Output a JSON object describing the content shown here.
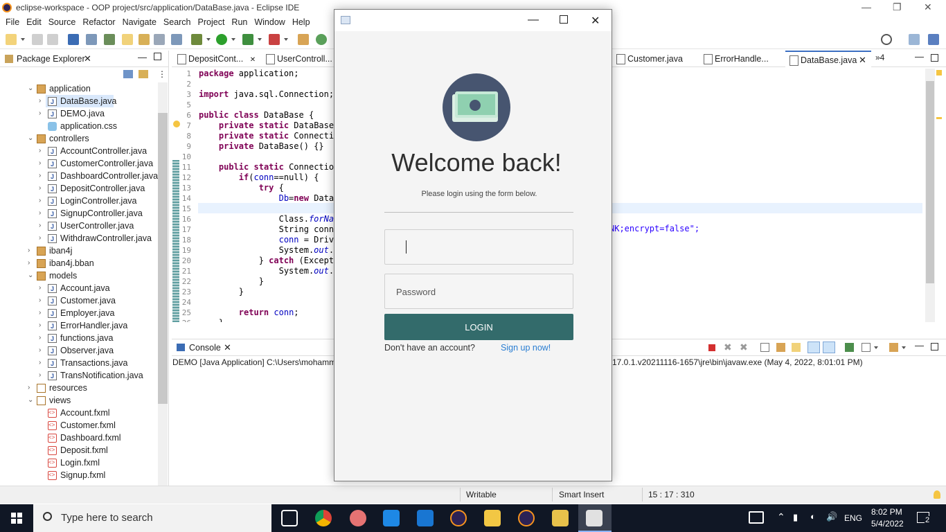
{
  "window": {
    "title": "eclipse-workspace - OOP project/src/application/DataBase.java - Eclipse IDE"
  },
  "menu": [
    "File",
    "Edit",
    "Source",
    "Refactor",
    "Navigate",
    "Search",
    "Project",
    "Run",
    "Window",
    "Help"
  ],
  "package_explorer": {
    "title": "Package Explorer",
    "tree": [
      {
        "label": "application",
        "type": "pkg",
        "level": 0,
        "expanded": true
      },
      {
        "label": "DataBase.java",
        "type": "java",
        "level": 1,
        "selected": true
      },
      {
        "label": "DEMO.java",
        "type": "java",
        "level": 1
      },
      {
        "label": "application.css",
        "type": "css",
        "level": 1
      },
      {
        "label": "controllers",
        "type": "pkg",
        "level": 0,
        "expanded": true
      },
      {
        "label": "AccountController.java",
        "type": "java",
        "level": 1
      },
      {
        "label": "CustomerController.java",
        "type": "java",
        "level": 1
      },
      {
        "label": "DashboardController.java",
        "type": "java",
        "level": 1
      },
      {
        "label": "DepositController.java",
        "type": "java",
        "level": 1
      },
      {
        "label": "LoginController.java",
        "type": "java",
        "level": 1
      },
      {
        "label": "SignupController.java",
        "type": "java",
        "level": 1
      },
      {
        "label": "UserController.java",
        "type": "java",
        "level": 1
      },
      {
        "label": "WithdrawController.java",
        "type": "java",
        "level": 1
      },
      {
        "label": "iban4j",
        "type": "pkg",
        "level": 0
      },
      {
        "label": "iban4j.bban",
        "type": "pkg",
        "level": 0
      },
      {
        "label": "models",
        "type": "pkg",
        "level": 0,
        "expanded": true
      },
      {
        "label": "Account.java",
        "type": "java",
        "level": 1
      },
      {
        "label": "Customer.java",
        "type": "java",
        "level": 1
      },
      {
        "label": "Employer.java",
        "type": "java",
        "level": 1
      },
      {
        "label": "ErrorHandler.java",
        "type": "java",
        "level": 1
      },
      {
        "label": "functions.java",
        "type": "java",
        "level": 1
      },
      {
        "label": "Observer.java",
        "type": "java",
        "level": 1
      },
      {
        "label": "Transactions.java",
        "type": "java",
        "level": 1
      },
      {
        "label": "TransNotification.java",
        "type": "java",
        "level": 1
      },
      {
        "label": "resources",
        "type": "res",
        "level": 0
      },
      {
        "label": "views",
        "type": "res",
        "level": 0,
        "expanded": true
      },
      {
        "label": "Account.fxml",
        "type": "fxml",
        "level": 1
      },
      {
        "label": "Customer.fxml",
        "type": "fxml",
        "level": 1
      },
      {
        "label": "Dashboard.fxml",
        "type": "fxml",
        "level": 1
      },
      {
        "label": "Deposit.fxml",
        "type": "fxml",
        "level": 1
      },
      {
        "label": "Login.fxml",
        "type": "fxml",
        "level": 1
      },
      {
        "label": "Signup.fxml",
        "type": "fxml",
        "level": 1
      }
    ]
  },
  "editor_tabs": [
    {
      "label": "DepositCont..."
    },
    {
      "label": "UserControll..."
    },
    {
      "label": "Customer.java"
    },
    {
      "label": "ErrorHandle..."
    },
    {
      "label": "DataBase.java",
      "active": true
    }
  ],
  "editor_overflow": "»4",
  "code_lines": [
    {
      "n": "1",
      "text": "package application;"
    },
    {
      "n": "2",
      "text": ""
    },
    {
      "n": "3",
      "text": "import java.sql.Connection;"
    },
    {
      "n": "5",
      "text": ""
    },
    {
      "n": "6",
      "text": "public class DataBase {"
    },
    {
      "n": "7",
      "text": "    private static DataBase"
    },
    {
      "n": "8",
      "text": "    private static Connectio"
    },
    {
      "n": "9",
      "text": "    private DataBase() {}"
    },
    {
      "n": "10",
      "text": ""
    },
    {
      "n": "11",
      "text": "    public static Connection"
    },
    {
      "n": "12",
      "text": "        if(conn==null) {"
    },
    {
      "n": "13",
      "text": "            try {"
    },
    {
      "n": "14",
      "text": "                Db=new DataB"
    },
    {
      "n": "15",
      "text": ""
    },
    {
      "n": "16",
      "text": "                Class.forNam"
    },
    {
      "n": "17",
      "text": "                String conne"
    },
    {
      "n": "18",
      "text": "                conn = Drive"
    },
    {
      "n": "19",
      "text": "                System.out.p"
    },
    {
      "n": "20",
      "text": "            } catch (Excepti"
    },
    {
      "n": "21",
      "text": "                System.out.p"
    },
    {
      "n": "22",
      "text": "            }"
    },
    {
      "n": "23",
      "text": "        }"
    },
    {
      "n": "24",
      "text": ""
    },
    {
      "n": "25",
      "text": "        return conn;"
    },
    {
      "n": "26",
      "text": "    }"
    }
  ],
  "code_tail_17": "NK;encrypt=false\";",
  "console": {
    "title": "Console",
    "launch_left": "DEMO [Java Application] C:\\Users\\mohamm",
    "launch_right": "17.0.1.v20211116-1657\\jre\\bin\\javaw.exe  (May 4, 2022, 8:01:01 PM)"
  },
  "status": {
    "writable": "Writable",
    "insert_mode": "Smart Insert",
    "position": "15 : 17 : 310"
  },
  "login": {
    "welcome": "Welcome back!",
    "subtitle": "Please login using the form below.",
    "username_value": "",
    "password_placeholder": "Password",
    "login_button": "LOGIN",
    "no_account": "Don't have an account?",
    "signup_link": "Sign up now!",
    "colors": {
      "button": "#336b6b",
      "logo_bg": "#475570",
      "link": "#2a7ed2"
    }
  },
  "taskbar": {
    "search_placeholder": "Type here to search",
    "language": "ENG",
    "time": "8:02 PM",
    "date": "5/4/2022",
    "notifications": "2"
  }
}
